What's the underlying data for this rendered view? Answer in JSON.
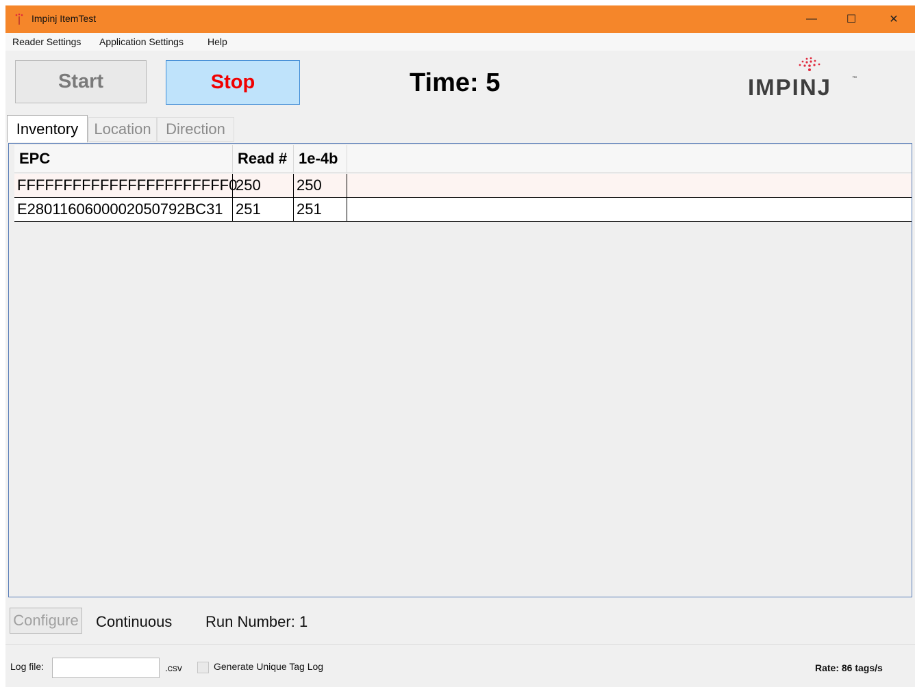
{
  "window": {
    "title": "Impinj ItemTest",
    "controls": {
      "minimize": "—",
      "maximize": "☐",
      "close": "✕"
    }
  },
  "menu": {
    "items": [
      {
        "label": "Reader Settings"
      },
      {
        "label": "Application Settings"
      },
      {
        "label": "Help"
      }
    ]
  },
  "toolbar": {
    "start_label": "Start",
    "stop_label": "Stop",
    "time_label": "Time: 5",
    "logo_text": "IMPINJ",
    "logo_tm": "™"
  },
  "tabs": [
    {
      "label": "Inventory",
      "active": true
    },
    {
      "label": "Location",
      "active": false
    },
    {
      "label": "Direction",
      "active": false
    }
  ],
  "grid": {
    "columns": [
      "EPC",
      "Read #",
      "1e-4b"
    ],
    "rows": [
      {
        "epc": "FFFFFFFFFFFFFFFFFFFFFFF0",
        "read": "250",
        "col3": "250"
      },
      {
        "epc": "E2801160600002050792BC31",
        "read": "251",
        "col3": "251"
      }
    ]
  },
  "bottom": {
    "configure_label": "Configure",
    "mode_label": "Continuous",
    "run_label": "Run Number: 1"
  },
  "status": {
    "log_file_label": "Log file:",
    "log_file_value": "",
    "csv_label": ".csv",
    "unique_tag_log_label": "Generate Unique Tag Log",
    "unique_tag_log_checked": false,
    "rate_label": "Rate: 86 tags/s"
  },
  "colors": {
    "titlebar": "#f5862a",
    "stop_text": "#f00000",
    "stop_bg": "#bfe3fb",
    "logo_dots": "#e0283c"
  }
}
